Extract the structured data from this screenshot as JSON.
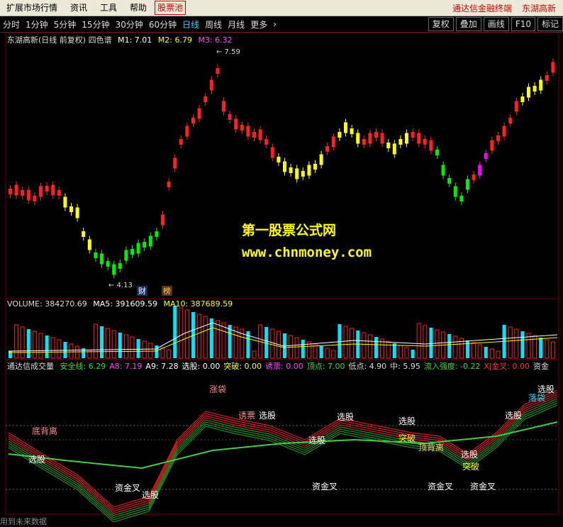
{
  "menubar": {
    "items": [
      "扩展市场行情",
      "资讯",
      "工具",
      "帮助"
    ],
    "stock_pool": "股票池",
    "right_links": [
      "通达信金融终端",
      "东湖高新"
    ]
  },
  "toolbar": {
    "periods": [
      "分时",
      "1分钟",
      "5分钟",
      "15分钟",
      "30分钟",
      "60分钟",
      "日线",
      "周线",
      "月线",
      "更多"
    ],
    "active_period": "日线",
    "buttons": [
      "复权",
      "叠加",
      "画线",
      "F10",
      "标记"
    ]
  },
  "main_chart": {
    "title": "东湖高新(日线 前复权) 四色谱",
    "m1": "M1: 7.01",
    "m2": "M2: 6.79",
    "m3": "M3: 6.32",
    "high_label": "7.59",
    "low_label": "4.13",
    "tags": [
      "财",
      "榜"
    ],
    "watermark_line1": "第一股票公式网",
    "watermark_line2": "www.chnmoney.com"
  },
  "volume_panel": {
    "volume": "VOLUME: 384270.69",
    "ma5": "MA5: 391609.59",
    "ma10": "MA10: 387689.59"
  },
  "indicator_panel": {
    "name": "通达信成交量",
    "fields": [
      {
        "text": "安全线: 6.29",
        "color": "#33dd33"
      },
      {
        "text": "A8: 7.19",
        "color": "#ff44ff"
      },
      {
        "text": "A9: 7.28",
        "color": "#ffffff"
      },
      {
        "text": "选股: 0.00",
        "color": "#ffffff"
      },
      {
        "text": "突破: 0.00",
        "color": "#ffff00"
      },
      {
        "text": "诱票: 0.00",
        "color": "#ff44ff"
      },
      {
        "text": "顶点: 7.00",
        "color": "#33dd33"
      },
      {
        "text": "低点: 4.90",
        "color": "#dddddd"
      },
      {
        "text": "中: 5.95",
        "color": "#dddddd"
      },
      {
        "text": "流入强度: -0.22",
        "color": "#33dd33"
      },
      {
        "text": "XJ金叉: 0.00",
        "color": "#ff3333"
      },
      {
        "text": "资金",
        "color": "#dddddd"
      }
    ],
    "labels": {
      "di_bei_li": "底背离",
      "xuan_gu": "选股",
      "zi_jin_cha": "资金叉",
      "tu_po": "突破",
      "zhang_dai": "涨袋",
      "you_piao": "诱票",
      "ding_bei_li": "顶背离",
      "luo_dai": "落袋"
    }
  },
  "footer": {
    "text": "用到未来数据"
  },
  "colors": {
    "red": "#ff2020",
    "yellow": "#ffff00",
    "green": "#00ee00",
    "cyan": "#00e5ff",
    "magenta": "#ff00ff"
  }
}
